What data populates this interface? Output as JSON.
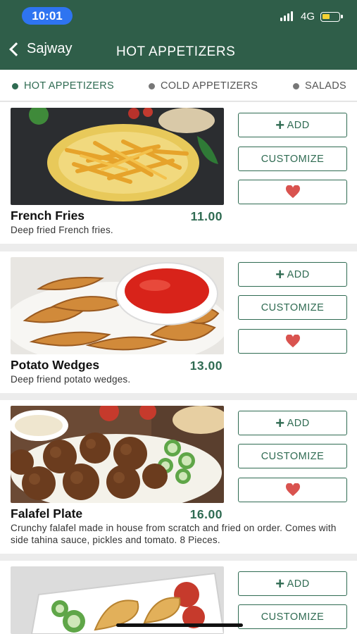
{
  "status_bar": {
    "time": "10:01",
    "network": "4G"
  },
  "nav": {
    "back_label": "Sajway",
    "title": "HOT APPETIZERS"
  },
  "tabs": [
    {
      "label": "HOT APPETIZERS",
      "active": true
    },
    {
      "label": "COLD APPETIZERS",
      "active": false
    },
    {
      "label": "SALADS",
      "active": false
    }
  ],
  "buttons": {
    "add": "ADD",
    "customize": "CUSTOMIZE"
  },
  "items": [
    {
      "name": "French Fries",
      "price": "11.00",
      "description": "Deep fried French fries."
    },
    {
      "name": "Potato Wedges",
      "price": "13.00",
      "description": "Deep friend potato wedges."
    },
    {
      "name": "Falafel Plate",
      "price": "16.00",
      "description": "Crunchy falafel made in house from scratch and fried on order. Comes with side tahina sauce, pickles and tomato. 8 Pieces."
    }
  ],
  "colors": {
    "header": "#2f5e49",
    "accent": "#2f6b52",
    "heart": "#d9534f",
    "inactive_tab": "#555555"
  },
  "icons": [
    "chevron-left-icon",
    "plus-icon",
    "heart-icon",
    "signal-icon",
    "battery-icon"
  ]
}
